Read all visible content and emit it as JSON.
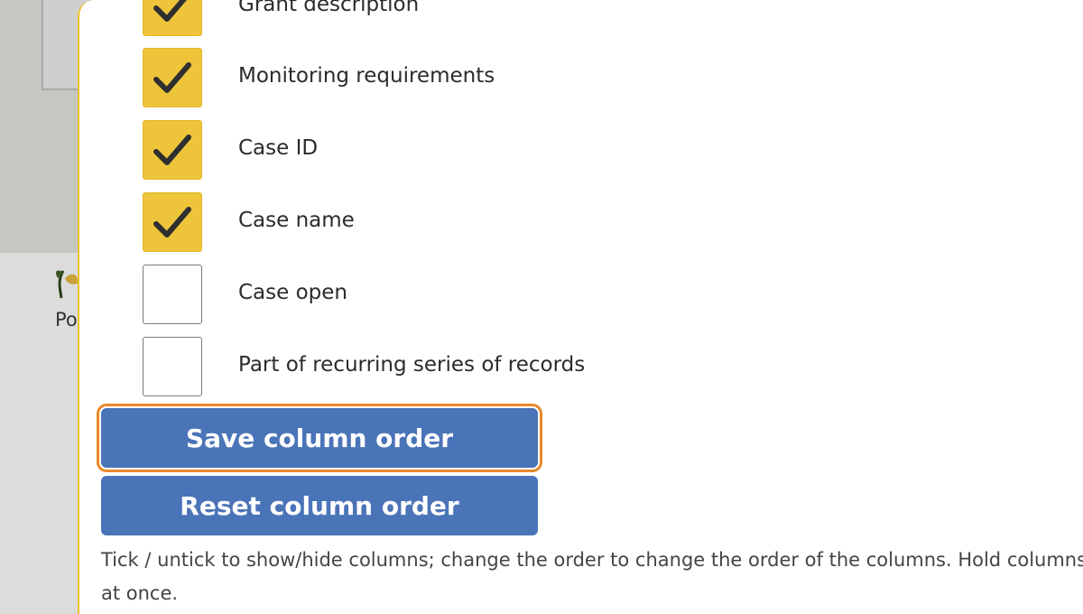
{
  "background": {
    "label_fragment": "Po"
  },
  "columns": [
    {
      "label": "Grant description",
      "checked": true
    },
    {
      "label": "Monitoring requirements",
      "checked": true
    },
    {
      "label": "Case ID",
      "checked": true
    },
    {
      "label": "Case name",
      "checked": true
    },
    {
      "label": "Case open",
      "checked": false
    },
    {
      "label": "Part of recurring series of records",
      "checked": false
    }
  ],
  "buttons": {
    "save_label": "Save column order",
    "reset_label": "Reset column order"
  },
  "help": {
    "text": "Tick / untick to show/hide columns; change the order to change the order of the columns. Hold columns at once."
  },
  "colors": {
    "accent_yellow": "#eec53a",
    "button_blue": "#4a74b8",
    "focus_orange": "#e8892b"
  },
  "icons": {
    "checkmark": "checkmark-icon"
  }
}
